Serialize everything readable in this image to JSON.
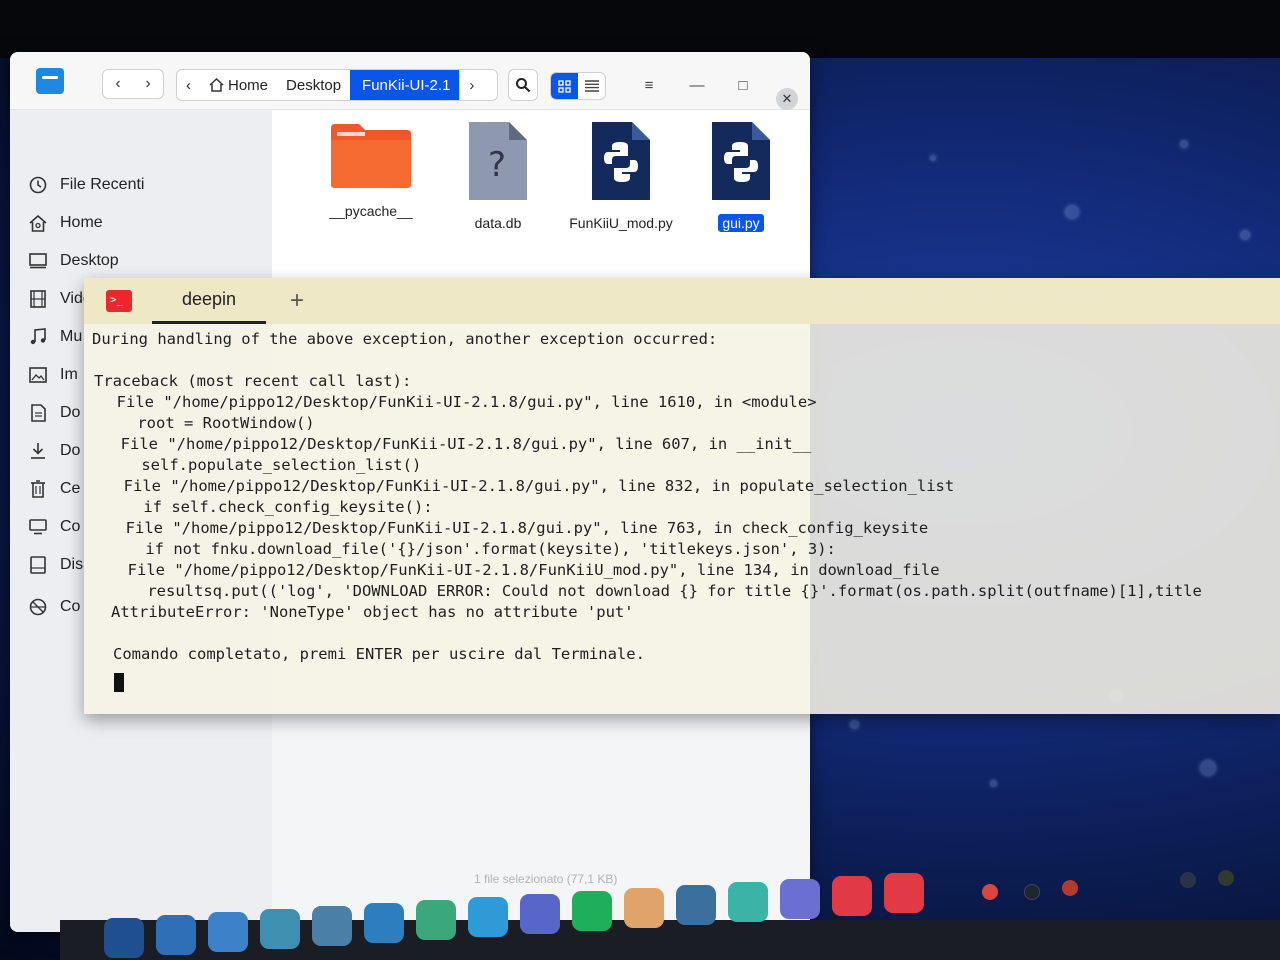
{
  "file_manager": {
    "breadcrumbs": [
      "Home",
      "Desktop",
      "FunKii-UI-2.1"
    ],
    "sidebar": [
      {
        "label": "File Recenti",
        "icon": "clock-icon"
      },
      {
        "label": "Home",
        "icon": "home-icon"
      },
      {
        "label": "Desktop",
        "icon": "desktop-icon"
      },
      {
        "label": "Video",
        "icon": "video-icon"
      },
      {
        "label": "Mu",
        "icon": "music-icon"
      },
      {
        "label": "Im",
        "icon": "image-icon"
      },
      {
        "label": "Do",
        "icon": "document-icon"
      },
      {
        "label": "Do",
        "icon": "download-icon"
      },
      {
        "label": "Ce",
        "icon": "trash-icon"
      },
      {
        "label": "Co",
        "icon": "computer-icon"
      },
      {
        "label": "Dis",
        "icon": "disk-icon"
      },
      {
        "label": "Co",
        "icon": "network-icon"
      }
    ],
    "files": [
      {
        "name": "__pycache__",
        "icon": "folder-icon"
      },
      {
        "name": "data.db",
        "icon": "unknown-file-icon"
      },
      {
        "name": "FunKiiU_mod.py",
        "icon": "python-file-icon"
      },
      {
        "name": "gui.py",
        "icon": "python-file-icon",
        "selected": true
      }
    ],
    "status": "1 file selezionato (77,1 KB)"
  },
  "terminal": {
    "tab_label": "deepin",
    "new_tab_label": "+",
    "lines": [
      "During handling of the above exception, another exception occurred:",
      "",
      "Traceback (most recent call last):",
      "  File \"/home/pippo12/Desktop/FunKii-UI-2.1.8/gui.py\", line 1610, in <module>",
      "    root = RootWindow()",
      "  File \"/home/pippo12/Desktop/FunKii-UI-2.1.8/gui.py\", line 607, in __init__",
      "    self.populate_selection_list()",
      "  File \"/home/pippo12/Desktop/FunKii-UI-2.1.8/gui.py\", line 832, in populate_selection_list",
      "    if self.check_config_keysite():",
      "  File \"/home/pippo12/Desktop/FunKii-UI-2.1.8/gui.py\", line 763, in check_config_keysite",
      "    if not fnku.download_file('{}/json'.format(keysite), 'titlekeys.json', 3):",
      "  File \"/home/pippo12/Desktop/FunKii-UI-2.1.8/FunKiiU_mod.py\", line 134, in download_file",
      "    resultsq.put(('log', 'DOWNLOAD ERROR: Could not download {} for title {}'.format(os.path.split(outfname)[1],title",
      "AttributeError: 'NoneType' object has no attribute 'put'",
      "",
      "Comando completato, premi ENTER per uscire dal Terminale."
    ]
  },
  "dock": {
    "items": [
      {
        "name": "launcher-icon",
        "color": "#1f4f8f"
      },
      {
        "name": "multitask-icon",
        "color": "#2e6fb8"
      },
      {
        "name": "file-manager-icon",
        "color": "#3c82c9"
      },
      {
        "name": "music-icon",
        "color": "#3f8fb0"
      },
      {
        "name": "settings-icon",
        "color": "#4a7fa8"
      },
      {
        "name": "system-monitor-icon",
        "color": "#2d7ebf"
      },
      {
        "name": "app-store-icon",
        "color": "#3aa87a"
      },
      {
        "name": "telegram-icon",
        "color": "#2f9bd6"
      },
      {
        "name": "discord-icon",
        "color": "#5865c9"
      },
      {
        "name": "spotify-icon",
        "color": "#1fae5a"
      },
      {
        "name": "deepin-mail-icon",
        "color": "#e0a46a"
      },
      {
        "name": "trash-icon",
        "color": "#3a6f9e"
      },
      {
        "name": "download-manager-icon",
        "color": "#3cb3a7"
      },
      {
        "name": "file-manager-running-icon",
        "color": "#6b6fd0"
      },
      {
        "name": "terminal-icon",
        "color": "#e23a44"
      },
      {
        "name": "terminal-icon-2",
        "color": "#e23a44"
      }
    ]
  }
}
